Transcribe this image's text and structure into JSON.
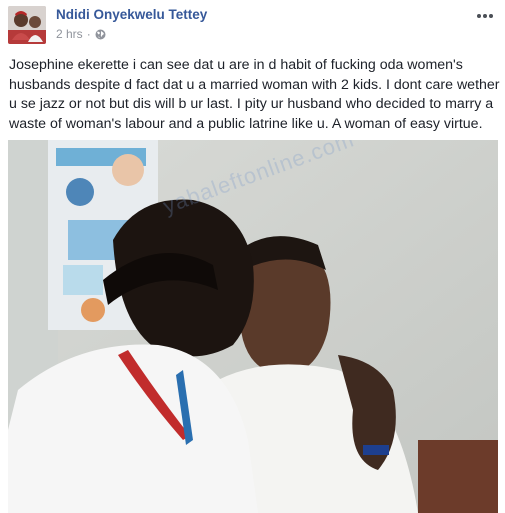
{
  "post": {
    "author": "Ndidi Onyekwelu Tettey",
    "timestamp": "2 hrs",
    "separator": "·",
    "audience_icon": "globe-icon",
    "more_icon": "more-options-icon",
    "text_lines": [
      "Josephine ekerette i can see dat u are in d habit of fucking oda women's",
      "husbands despite d fact dat u a married woman with 2 kids. I dont care wether",
      "u se jazz or not but dis will b ur last. I pity ur husband who decided to marry a",
      "waste of woman's labour and a public latrine like u. A woman of easy virtue."
    ],
    "watermark": "yabaleftonline.com"
  },
  "colors": {
    "author_link": "#365899",
    "meta_gray": "#90949c",
    "text": "#1d2129"
  }
}
